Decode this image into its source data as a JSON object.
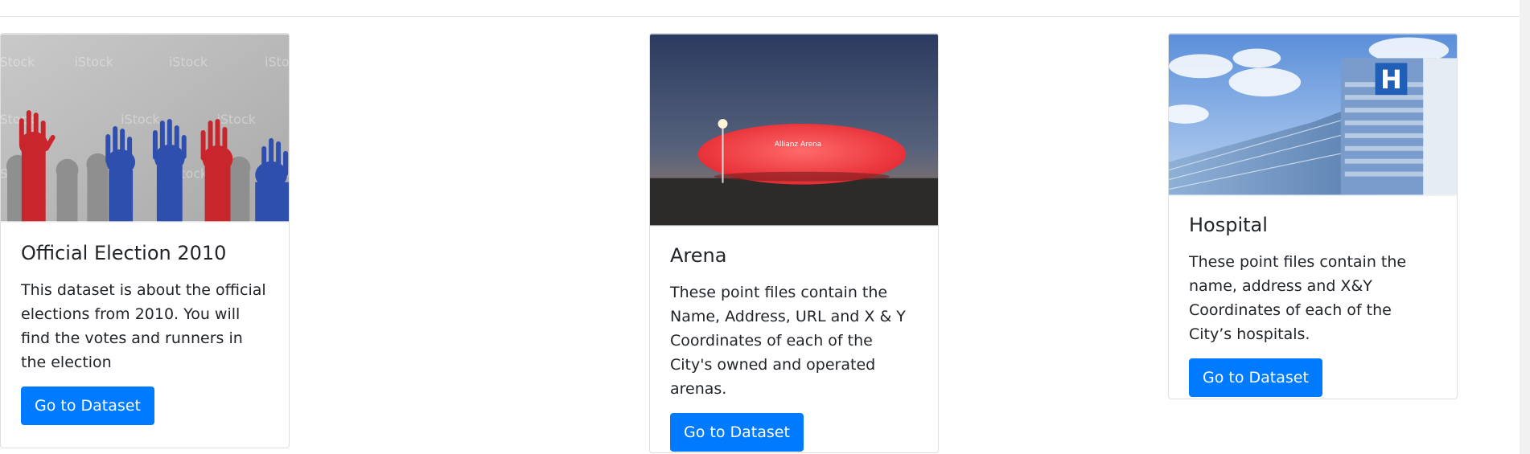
{
  "cards": [
    {
      "title": "Official Election 2010",
      "text": "This dataset is about the official elections from 2010. You will find the votes and runners in the election",
      "button": "Go to Dataset",
      "image": {
        "subject": "raised hands with VOTE labels",
        "watermark": "iStock"
      }
    },
    {
      "title": "Arena",
      "text": "These point files contain the Name, Address, URL and X & Y Coordinates of each of the City's owned and operated arenas.",
      "button": "Go to Dataset",
      "image": {
        "subject": "illuminated red stadium at dusk",
        "signage": "Allianz Arena"
      }
    },
    {
      "title": "Hospital",
      "text": "These point files contain the name, address and X&Y Coordinates of each of the City’s hospitals.",
      "button": "Go to Dataset",
      "image": {
        "subject": "modern hospital building with H sign",
        "sign": "H"
      }
    }
  ],
  "colors": {
    "button": "#007bff",
    "card_border": "rgba(0,0,0,.125)",
    "vote_red": "#c8262c",
    "vote_blue": "#2f4fae",
    "arena_red": "#ff3b3b"
  }
}
